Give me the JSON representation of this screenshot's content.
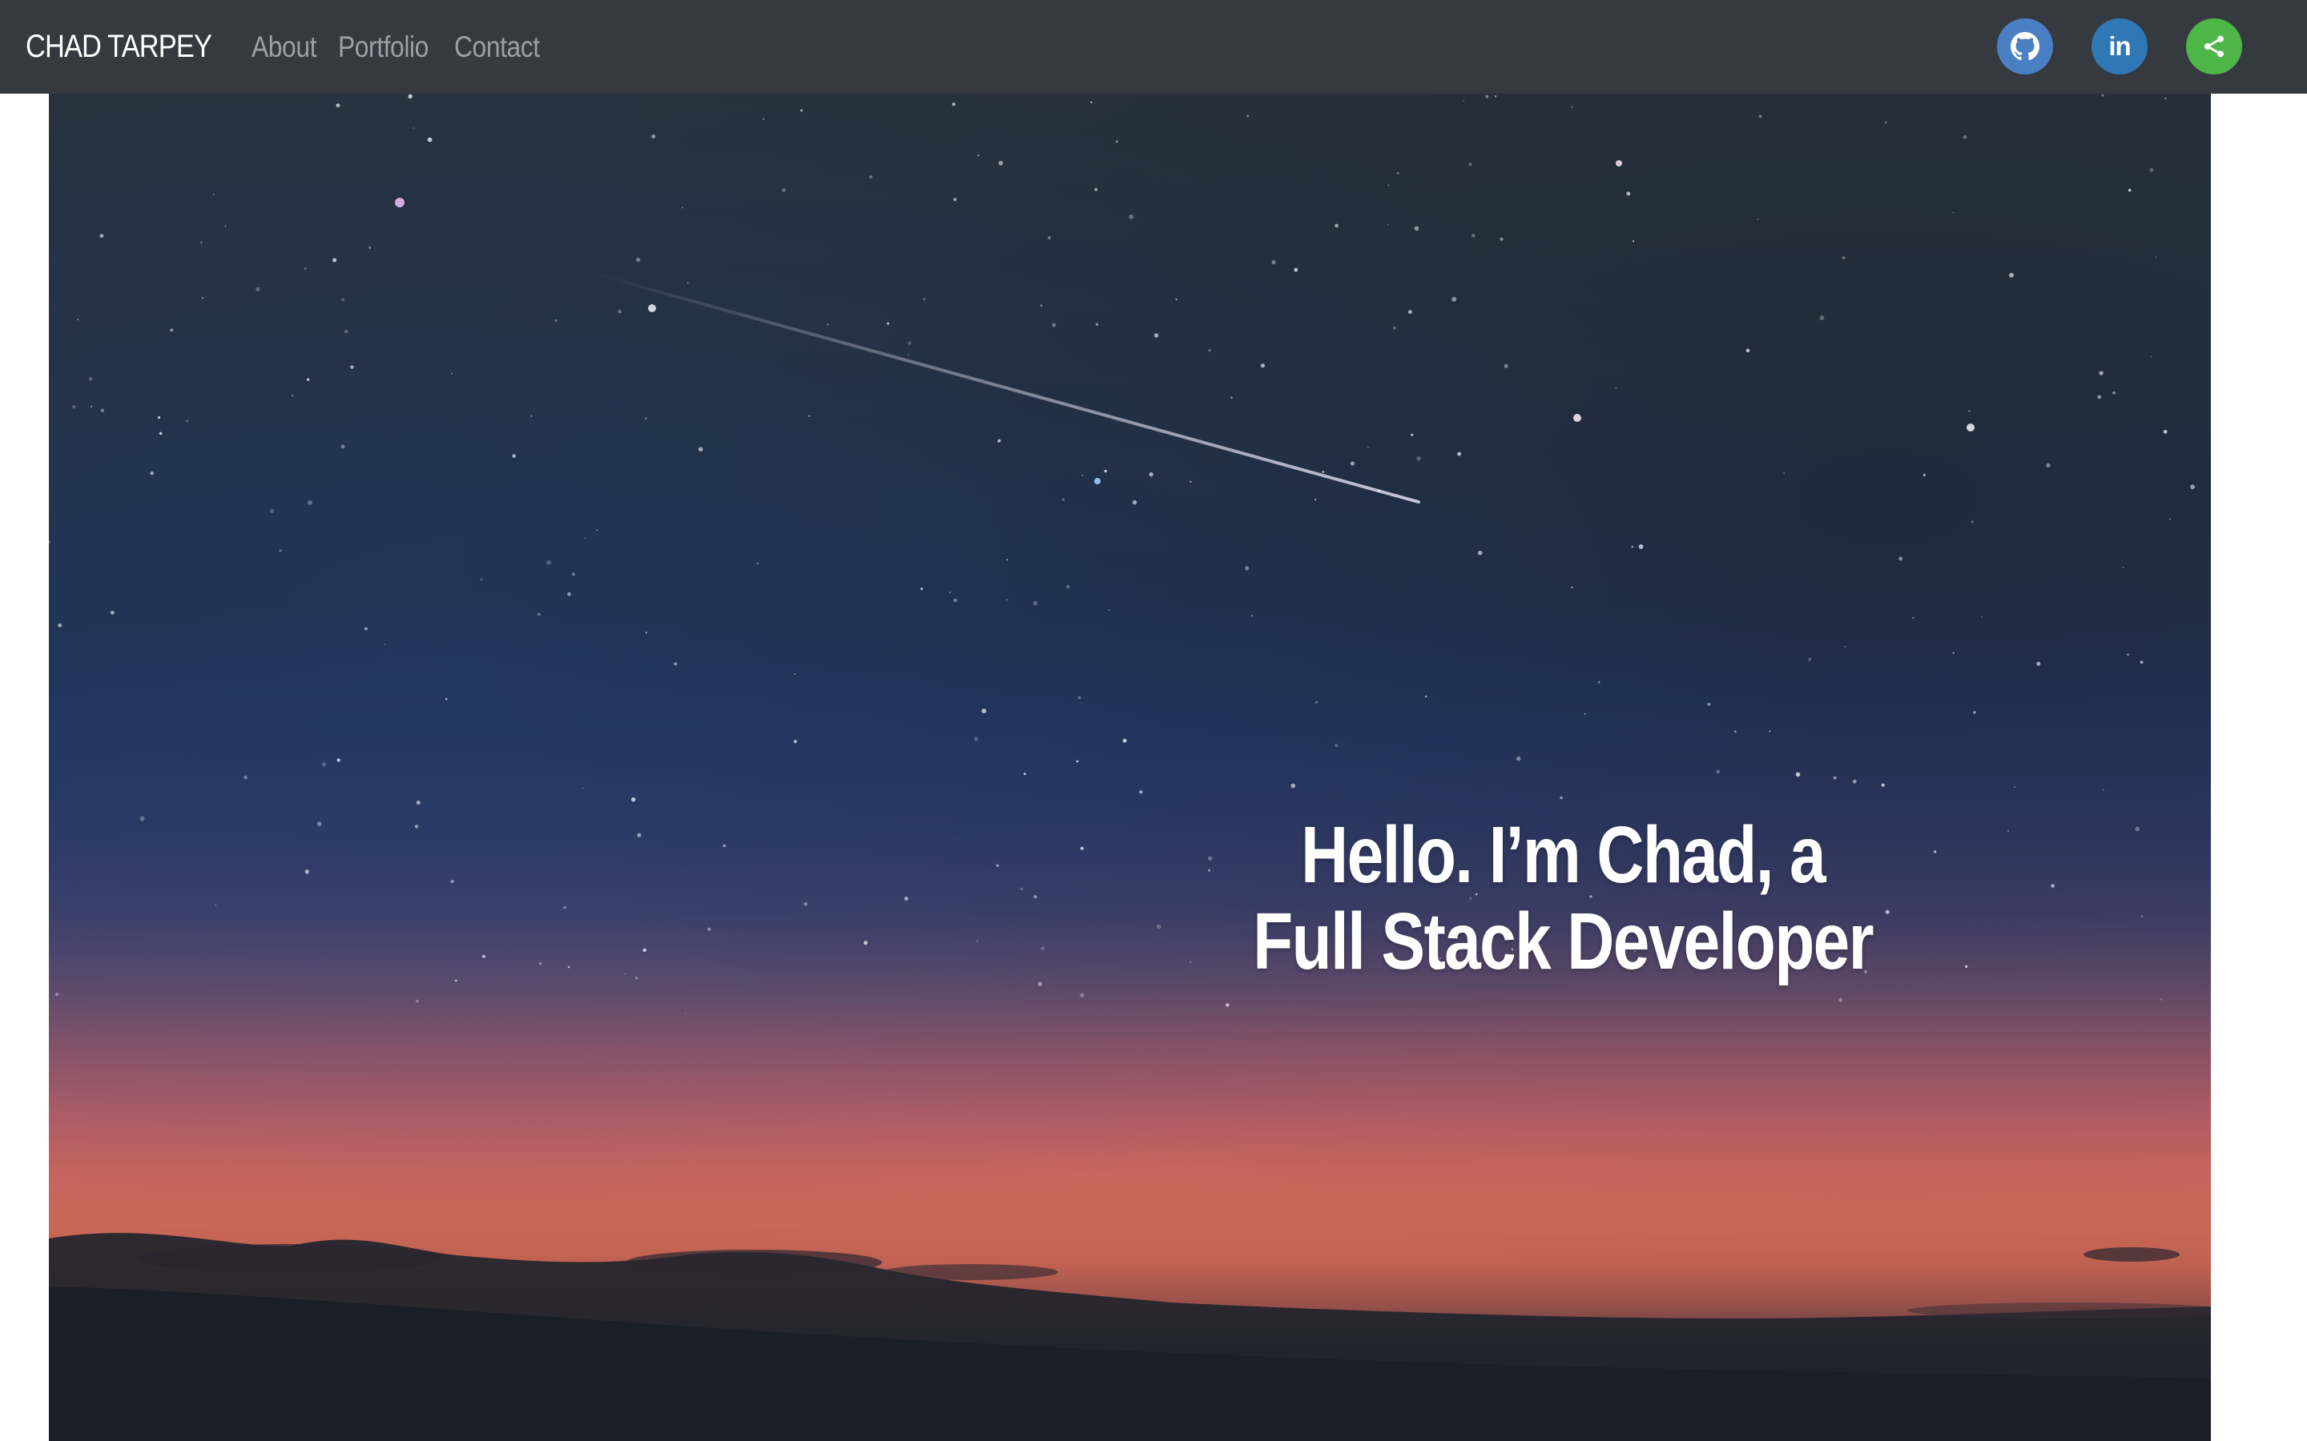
{
  "navbar": {
    "brand": "CHAD TARPEY",
    "links": [
      {
        "label": "About"
      },
      {
        "label": "Portfolio"
      },
      {
        "label": "Contact"
      }
    ],
    "social": [
      {
        "name": "github-icon",
        "color": "#4a7fc4"
      },
      {
        "name": "linkedin-icon",
        "label": "in",
        "color": "#2f77b5"
      },
      {
        "name": "share-icon",
        "color": "#4eb549"
      }
    ],
    "background_color": "#343a40"
  },
  "hero": {
    "title": "Hello. I’m Chad, a Full Stack Developer"
  }
}
